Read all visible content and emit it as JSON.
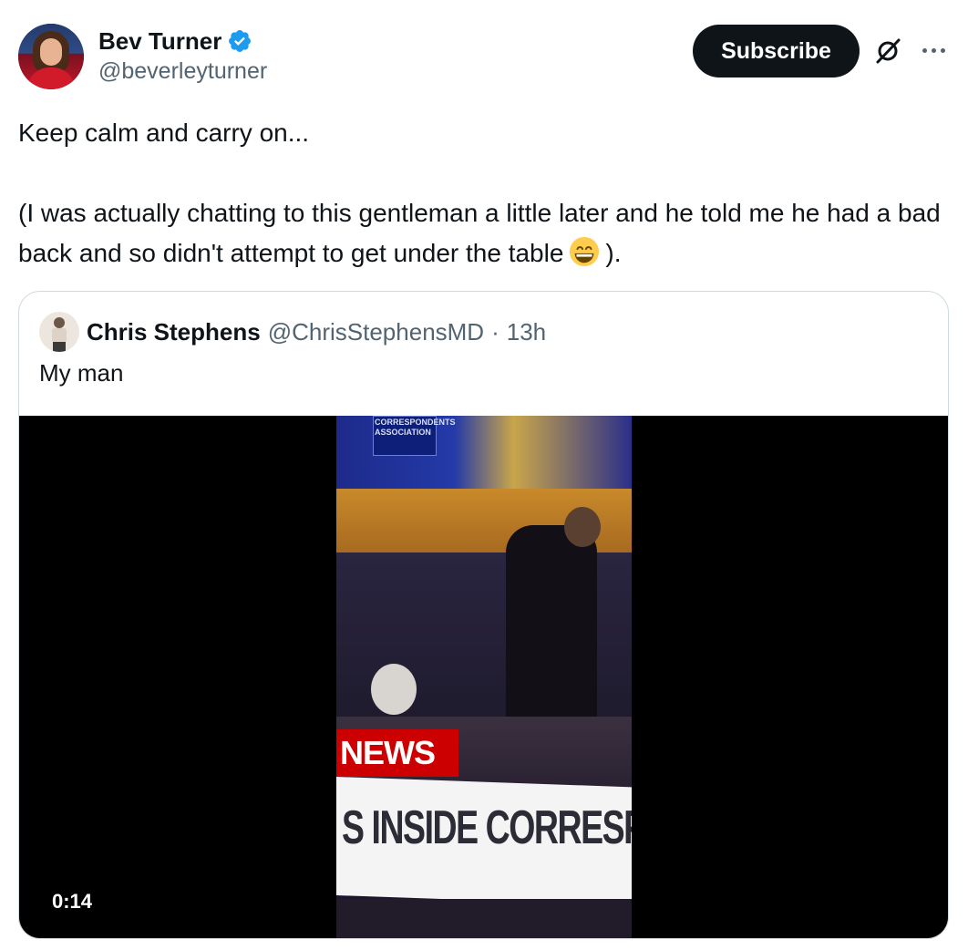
{
  "author": {
    "display_name": "Bev Turner",
    "handle": "@beverleyturner",
    "verified": true
  },
  "actions": {
    "subscribe_label": "Subscribe",
    "grok_icon": "grok-icon",
    "more_icon": "more-icon"
  },
  "tweet": {
    "line1": "Keep calm and carry on...",
    "line2_part1": "(I was actually chatting to this gentleman a little later and he told me he had a bad back and so didn't attempt to get under the table",
    "line2_emoji": "grinning-face-emoji",
    "line2_part2": ")."
  },
  "quoted_tweet": {
    "display_name": "Chris Stephens",
    "handle": "@ChrisStephensMD",
    "separator": "·",
    "time": "13h",
    "text": "My man",
    "video": {
      "duration": "0:14",
      "news_tag": "NEWS",
      "chyron": "S INSIDE CORRESPON",
      "banner": "CORRESPONDENTS ASSOCIATION"
    }
  },
  "colors": {
    "text_primary": "#0f1419",
    "text_secondary": "#536471",
    "verified_blue": "#1d9bf0",
    "subscribe_bg": "#0f1419",
    "border": "#cfd9de"
  }
}
